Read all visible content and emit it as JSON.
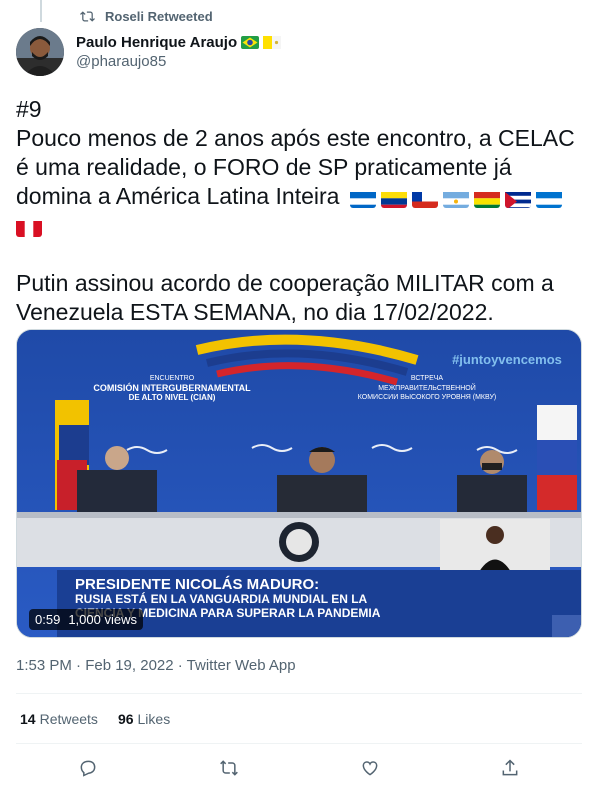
{
  "retweet_banner": {
    "text": "Roseli Retweeted",
    "icon": "retweet-icon"
  },
  "author": {
    "display_name": "Paulo Henrique Araujo",
    "username": "@pharaujo85",
    "flags": [
      "brazil-flag",
      "vatican-flag"
    ]
  },
  "tweet": {
    "line1": "#9",
    "paragraph1": "Pouco menos de 2 anos após este encontro, a CELAC é uma realidade, o FORO de SP praticamente já domina a América Latina Inteira",
    "paragraph1_flags": [
      "nicaragua",
      "venezuela",
      "chile",
      "argentina",
      "bolivia",
      "cuba",
      "honduras",
      "peru"
    ],
    "paragraph2": "Putin assinou acordo de cooperação MILITAR com a Venezuela ESTA SEMANA, no dia 17/02/2022."
  },
  "video": {
    "duration": "0:59",
    "views": "1,000 views",
    "banner_left": "ENCUENTRO COMISIÓN INTERGUBERNAMENTAL DE ALTO NIVEL (CIAN)",
    "banner_right": "ВСТРЕЧА МЕЖПРАВИТЕЛЬСТВЕННОЙ КОМИССИИ ВЫСОКОГО УРОВНЯ (МКВУ)",
    "watermark": "#juntoyvencemos",
    "lower_third_title": "PRESIDENTE NICOLÁS MADURO:",
    "lower_third_sub1": "RUSIA ESTÁ EN LA VANGUARDIA MUNDIAL EN LA",
    "lower_third_sub2": "CIENCIA Y MEDICINA PARA SUPERAR LA PANDEMIA"
  },
  "meta": {
    "timestamp": "1:53 PM · Feb 19, 2022 · Twitter Web App"
  },
  "stats": {
    "retweets_count": "14",
    "retweets_label": "Retweets",
    "likes_count": "96",
    "likes_label": "Likes"
  },
  "actions": [
    "reply-icon",
    "retweet-icon",
    "like-icon",
    "share-icon"
  ],
  "colors": {
    "secondary_text": "#536471",
    "primary_text": "#0f1419",
    "divider": "#eff3f4"
  }
}
